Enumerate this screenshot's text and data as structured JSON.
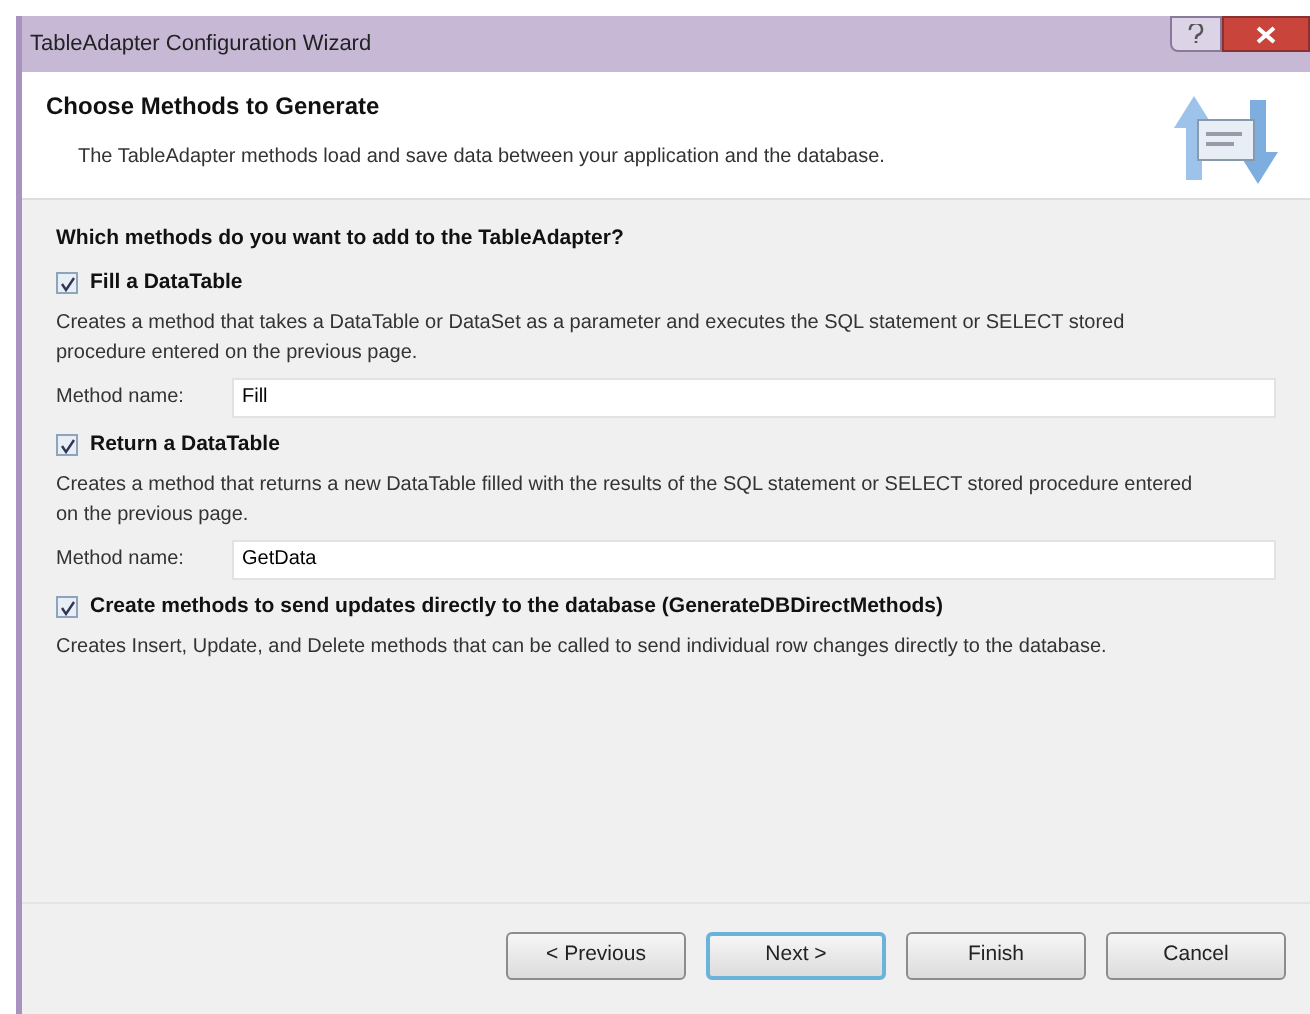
{
  "window": {
    "title": "TableAdapter Configuration Wizard"
  },
  "header": {
    "title": "Choose Methods to Generate",
    "subtitle": "The TableAdapter methods load and save data between your application and the database."
  },
  "question": "Which methods do you want to add to the TableAdapter?",
  "options": [
    {
      "label": "Fill a DataTable",
      "checked": true,
      "description": "Creates a method that takes a DataTable or DataSet as a parameter and executes the SQL statement or SELECT stored procedure entered on the previous page.",
      "method_label": "Method name:",
      "method_name": "Fill"
    },
    {
      "label": "Return a DataTable",
      "checked": true,
      "description": "Creates a method that returns a new DataTable filled with the results of the SQL statement or SELECT stored procedure entered on the previous page.",
      "method_label": "Method name:",
      "method_name": "GetData"
    },
    {
      "label": "Create methods to send updates directly to the database (GenerateDBDirectMethods)",
      "checked": true,
      "description": "Creates Insert, Update, and Delete methods that can be called to send individual row changes directly to the database."
    }
  ],
  "buttons": [
    {
      "label": "< Previous",
      "default": false
    },
    {
      "label": "Next >",
      "default": true
    },
    {
      "label": "Finish",
      "default": false
    },
    {
      "label": "Cancel",
      "default": false
    }
  ]
}
